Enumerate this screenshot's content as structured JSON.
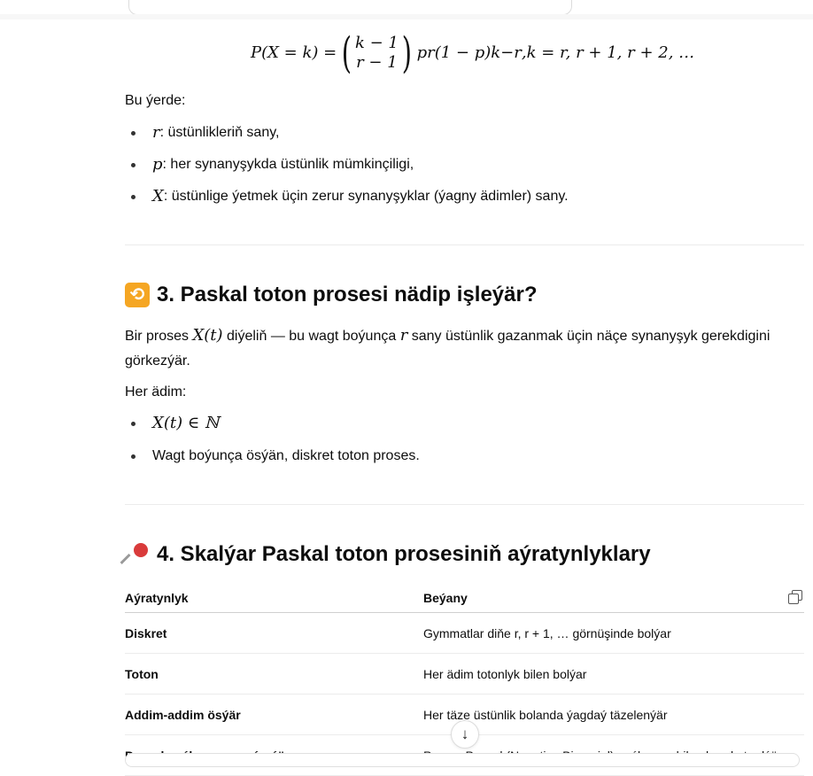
{
  "formula": {
    "lhs": "P(X = k) = ",
    "binom_top": "k − 1",
    "binom_bottom": "r − 1",
    "p_base": "p",
    "p_exp": "r",
    "q_base": "(1 − p)",
    "q_exp": "k−r",
    "trail": ",",
    "range": "k = r, r + 1, r + 2, …"
  },
  "intro": {
    "text": "Bu ýerde:"
  },
  "definitions": [
    {
      "symbol": "r",
      "text": ": üstünlikleriň sany,"
    },
    {
      "symbol": "p",
      "text": ": her synanyşykda üstünlik mümkinçiligi,"
    },
    {
      "symbol": "X",
      "text": ": üstünlige ýetmek üçin zerur synanyşyklar (ýagny ädimler) sany."
    }
  ],
  "section3": {
    "emoji": "🔁",
    "title": "3. Paskal toton prosesi nädip işleýär?",
    "para_pre": "Bir proses ",
    "para_sym": "X(t)",
    "para_mid": " diýeliň — bu wagt boýunça ",
    "para_sym2": "r",
    "para_post": " sany üstünlik gazanmak üçin näçe synanyşyk gerekdigini",
    "para_line2": "görkezýär.",
    "steps_label": "Her ädim:",
    "bullet1": "X(t) ∈ ℕ",
    "bullet2": "Wagt boýunça ösýän, diskret toton proses."
  },
  "section4": {
    "emoji": "📌",
    "title": "4. Skalýar Paskal toton prosesiniň aýratynlyklary",
    "table": {
      "headers": [
        "Aýratynlyk",
        "Beýany"
      ],
      "rows": [
        [
          "Diskret",
          "Gymmatlar diňe r, r + 1, … görnüşinde bolýar"
        ],
        [
          "Toton",
          "Her ädim totonlyk bilen bolýar"
        ],
        [
          "Addim-addim ösýär",
          "Her täze üstünlik bolanda ýagdaý täzelenýär"
        ],
        [
          "Pascal paýlanyşyna eýerýär",
          "Proses Pascal (Negative Binomial) paýlanyşy bilen hereket edýär"
        ]
      ]
    }
  },
  "icons": {
    "copy": "copy-icon",
    "scroll": "arrow-down-icon"
  },
  "scroll_glyph": "↓"
}
